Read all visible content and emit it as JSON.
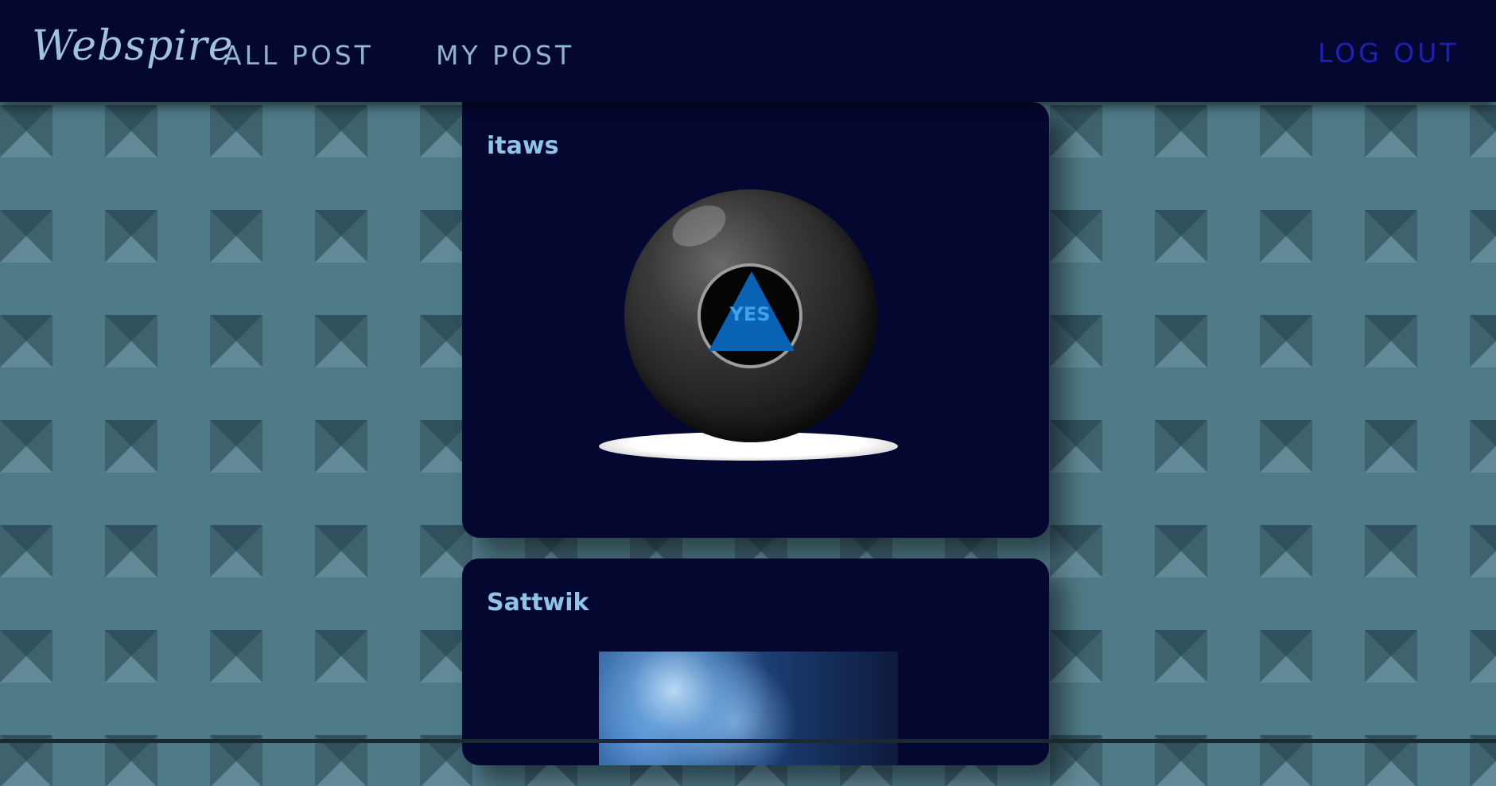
{
  "navbar": {
    "brand": "Webspire",
    "links": {
      "all_post": "ALL POST",
      "my_post": "MY POST",
      "log_out": "LOG OUT"
    }
  },
  "posts": [
    {
      "author": "itaws",
      "image_text": "YES",
      "image_icon": "magic-8-ball"
    },
    {
      "author": "Sattwik",
      "image_icon": "galaxy-photo"
    }
  ],
  "colors": {
    "nav_bg": "#040830",
    "nav_link": "#8fb4d2",
    "logout": "#2020b8",
    "author": "#8ec5e6",
    "card_bg": "#040830"
  }
}
